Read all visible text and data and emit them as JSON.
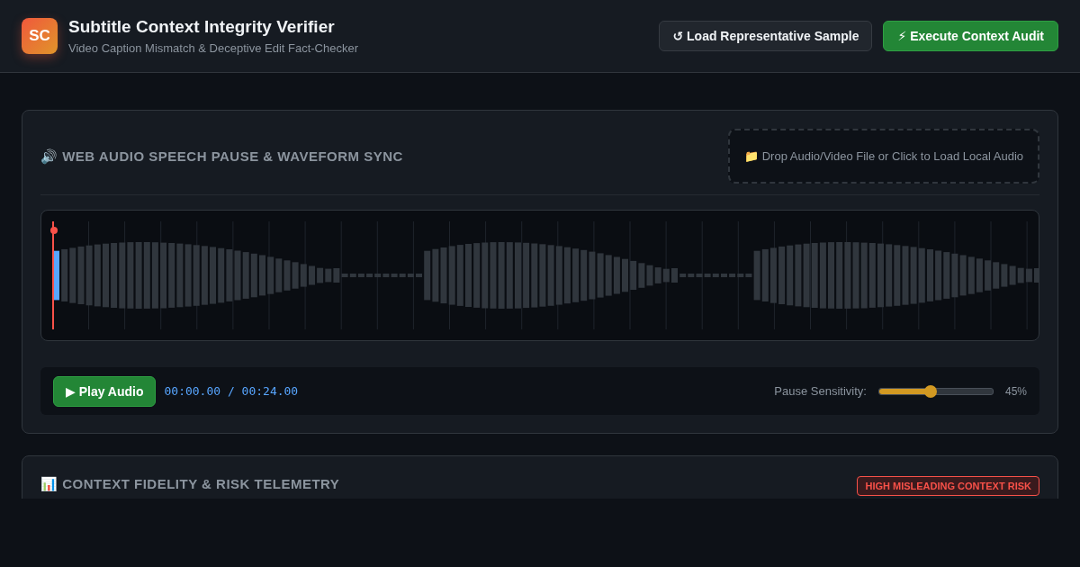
{
  "header": {
    "logo": "SC",
    "title": "Subtitle Context Integrity Verifier",
    "subtitle": "Video Caption Mismatch & Deceptive Edit Fact-Checker",
    "buttons": [
      {
        "kind": "secondary",
        "label": "↺ Load Representative Sample"
      },
      {
        "kind": "primary",
        "label": "⚡ Execute Context Audit"
      }
    ]
  },
  "audio_panel": {
    "title": "🔊 WEB AUDIO SPEECH PAUSE & WAVEFORM SYNC",
    "dropzone": "📁 Drop Audio/Video File or Click to Load Local Audio",
    "play_button": "▶ Play Audio",
    "time": "00:00.00 / 00:24.00",
    "sensitivity": {
      "label": "Pause Sensitivity:",
      "level": 0.45,
      "reading": "45%"
    }
  },
  "telemetry_panel": {
    "title": "📊 CONTEXT FIDELITY & RISK TELEMETRY",
    "badge": "HIGH MISLEADING CONTEXT RISK"
  }
}
